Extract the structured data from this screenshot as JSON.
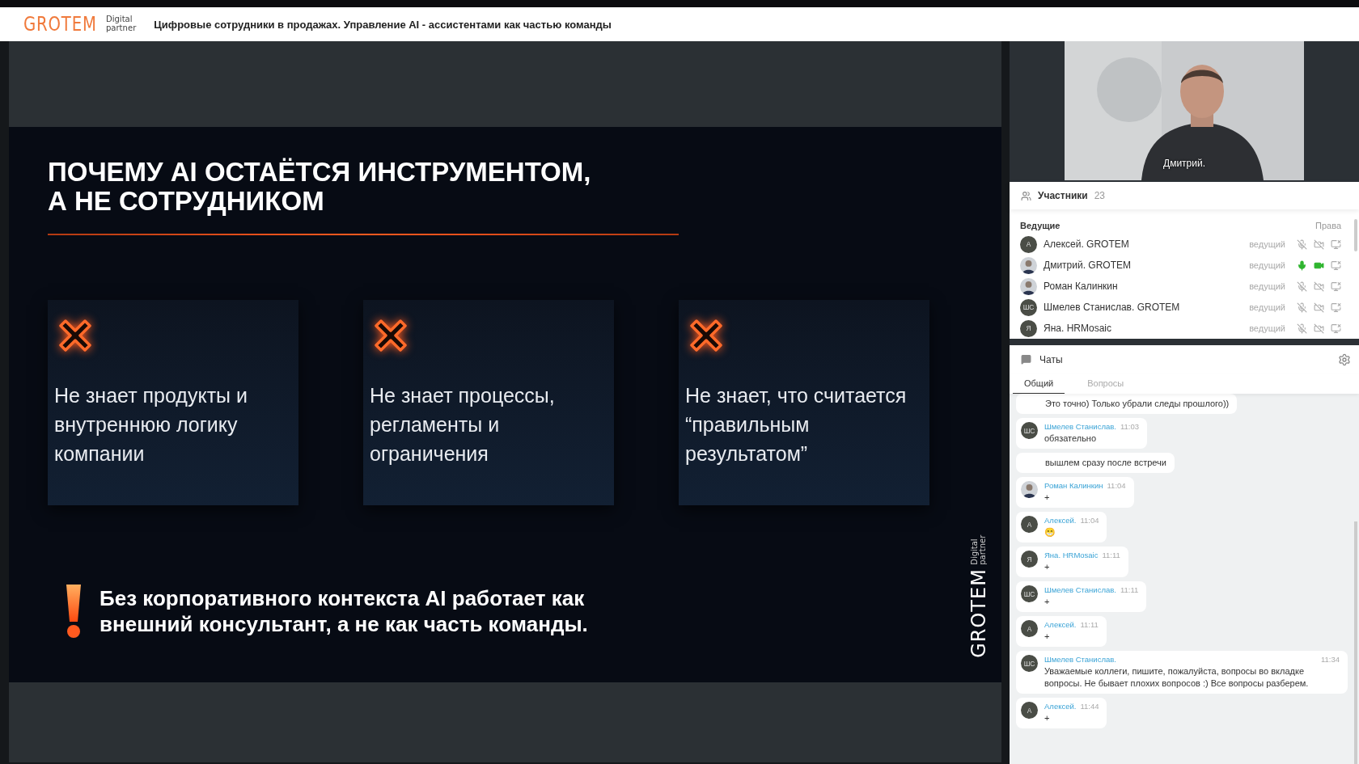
{
  "header": {
    "logo": "GROTEM",
    "logo_tagline": [
      "Digital",
      "partner"
    ],
    "title": "Цифровые сотрудники в продажах. Управление AI - ассистентами как частью команды"
  },
  "slide": {
    "title_lines": [
      "ПОЧЕМУ AI ОСТАЁТСЯ ИНСТРУМЕНТОМ,",
      "А НЕ СОТРУДНИКОМ"
    ],
    "cards": [
      {
        "lines": [
          "Не знает продукты и",
          "внутреннюю логику",
          "компании"
        ]
      },
      {
        "lines": [
          "Не знает процессы,",
          "регламенты и",
          "ограничения"
        ]
      },
      {
        "lines": [
          "Не знает, что считается",
          "“правильным",
          "результатом”"
        ]
      }
    ],
    "note_lines": [
      "Без корпоративного контекста AI работает как",
      "внешний консультант, а не как часть команды."
    ],
    "logo": "GROTEM",
    "logo_tagline": [
      "Digital",
      "partner"
    ]
  },
  "video": {
    "kind": "picture",
    "caption": "Дмитрий."
  },
  "participants": {
    "title": "Участники",
    "count": "23",
    "section": "Ведущие",
    "rights_label": "Права",
    "items": [
      {
        "name": "Алексей. GROTEM",
        "avatar_photo": false,
        "avatar": "А",
        "role": "ведущий",
        "mic_on": false,
        "cam_on": false
      },
      {
        "name": "Дмитрий. GROTEM",
        "avatar_photo": true,
        "role": "ведущий",
        "mic_on": true,
        "cam_on": true
      },
      {
        "name": "Роман Калинкин",
        "avatar_photo": true,
        "role": "ведущий",
        "mic_on": false,
        "cam_on": false
      },
      {
        "name": "Шмелев Станислав. GROTEM",
        "avatar_photo": false,
        "avatar": "ШС",
        "role": "ведущий",
        "mic_on": false,
        "cam_on": false
      },
      {
        "name": "Яна. HRMosaic",
        "avatar_photo": false,
        "avatar": "Я",
        "role": "ведущий",
        "mic_on": false,
        "cam_on": false
      }
    ]
  },
  "chat": {
    "title": "Чаты",
    "tabs": [
      {
        "label": "Общий",
        "selected": true
      },
      {
        "label": "Вопросы",
        "selected": false
      }
    ],
    "messages": [
      {
        "kind": "continuation",
        "text": "Это точно) Только убрали следы прошлого))"
      },
      {
        "kind": "message",
        "avatar_photo": false,
        "avatar": "ШС",
        "author": "Шмелев Станислав.",
        "time": "11:03",
        "text": "обязательно"
      },
      {
        "kind": "continuation",
        "text": "вышлем сразу после встречи"
      },
      {
        "kind": "message",
        "avatar_photo": true,
        "author": "Роман Калинкин",
        "time": "11:04",
        "text": "+"
      },
      {
        "kind": "message",
        "avatar_photo": false,
        "avatar": "А",
        "author": "Алексей.",
        "time": "11:04",
        "text": "😁"
      },
      {
        "kind": "message",
        "avatar_photo": false,
        "avatar": "Я",
        "author": "Яна. HRMosaic",
        "time": "11:11",
        "text": "+"
      },
      {
        "kind": "message",
        "avatar_photo": false,
        "avatar": "ШС",
        "author": "Шмелев Станислав.",
        "time": "11:11",
        "text": "+"
      },
      {
        "kind": "message",
        "avatar_photo": false,
        "avatar": "А",
        "author": "Алексей.",
        "time": "11:11",
        "text": "+"
      },
      {
        "kind": "wide",
        "avatar_photo": false,
        "avatar": "ШС",
        "author": "Шмелев Станислав.",
        "time": "11:34",
        "text": "Уважаемые коллеги, пишите, пожалуйста, вопросы во вкладке вопросы. Не бывает плохих вопросов :) Все вопросы разберем."
      },
      {
        "kind": "message",
        "avatar_photo": false,
        "avatar": "А",
        "author": "Алексей.",
        "time": "11:44",
        "text": "+"
      }
    ]
  }
}
